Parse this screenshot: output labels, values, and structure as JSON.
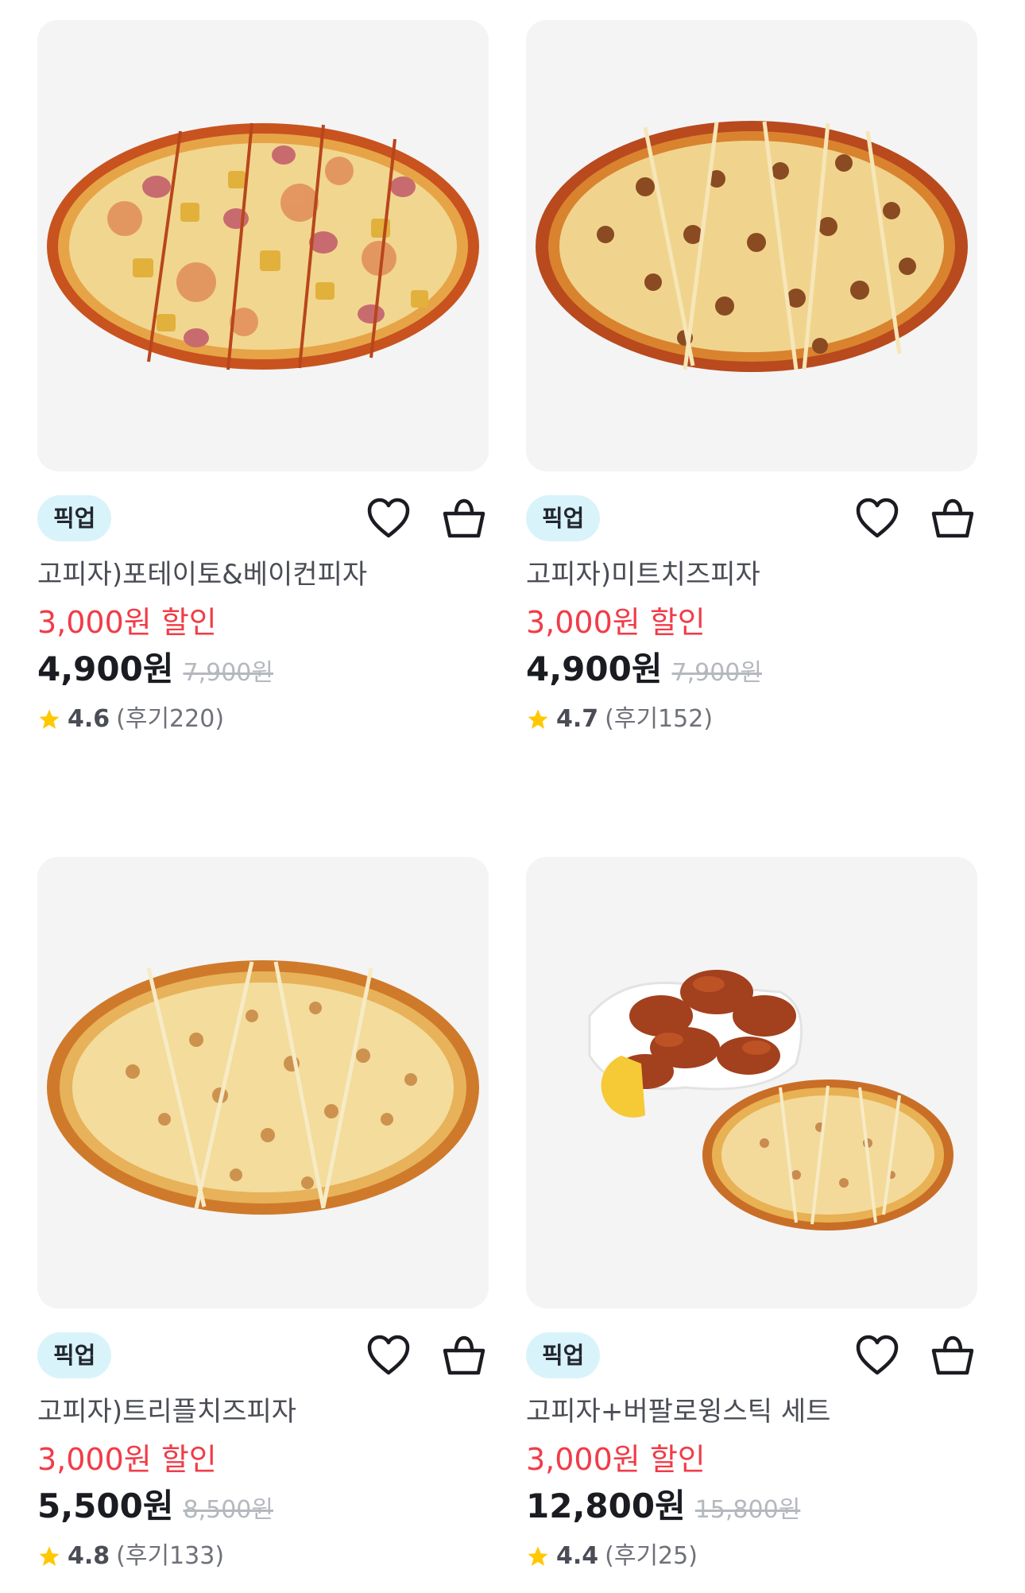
{
  "products": [
    {
      "badge": "픽업",
      "name": "고피자)포테이토&베이컨피자",
      "discount": "3,000원 할인",
      "price": "4,900원",
      "original_price": "7,900원",
      "rating": "4.6",
      "reviews": "(후기220)",
      "image": "potato-bacon-pizza-image"
    },
    {
      "badge": "픽업",
      "name": "고피자)미트치즈피자",
      "discount": "3,000원 할인",
      "price": "4,900원",
      "original_price": "7,900원",
      "rating": "4.7",
      "reviews": "(후기152)",
      "image": "meat-cheese-pizza-image"
    },
    {
      "badge": "픽업",
      "name": "고피자)트리플치즈피자",
      "discount": "3,000원 할인",
      "price": "5,500원",
      "original_price": "8,500원",
      "rating": "4.8",
      "reviews": "(후기133)",
      "image": "triple-cheese-pizza-image"
    },
    {
      "badge": "픽업",
      "name": "고피자+버팔로윙스틱 세트",
      "discount": "3,000원 할인",
      "price": "12,800원",
      "original_price": "15,800원",
      "rating": "4.4",
      "reviews": "(후기25)",
      "image": "pizza-buffalo-wing-set-image"
    }
  ],
  "colors": {
    "discount": "#f13c48",
    "badge_bg": "#d9f3fb",
    "star": "#ffc800",
    "thumb_bg": "#f4f4f5"
  }
}
